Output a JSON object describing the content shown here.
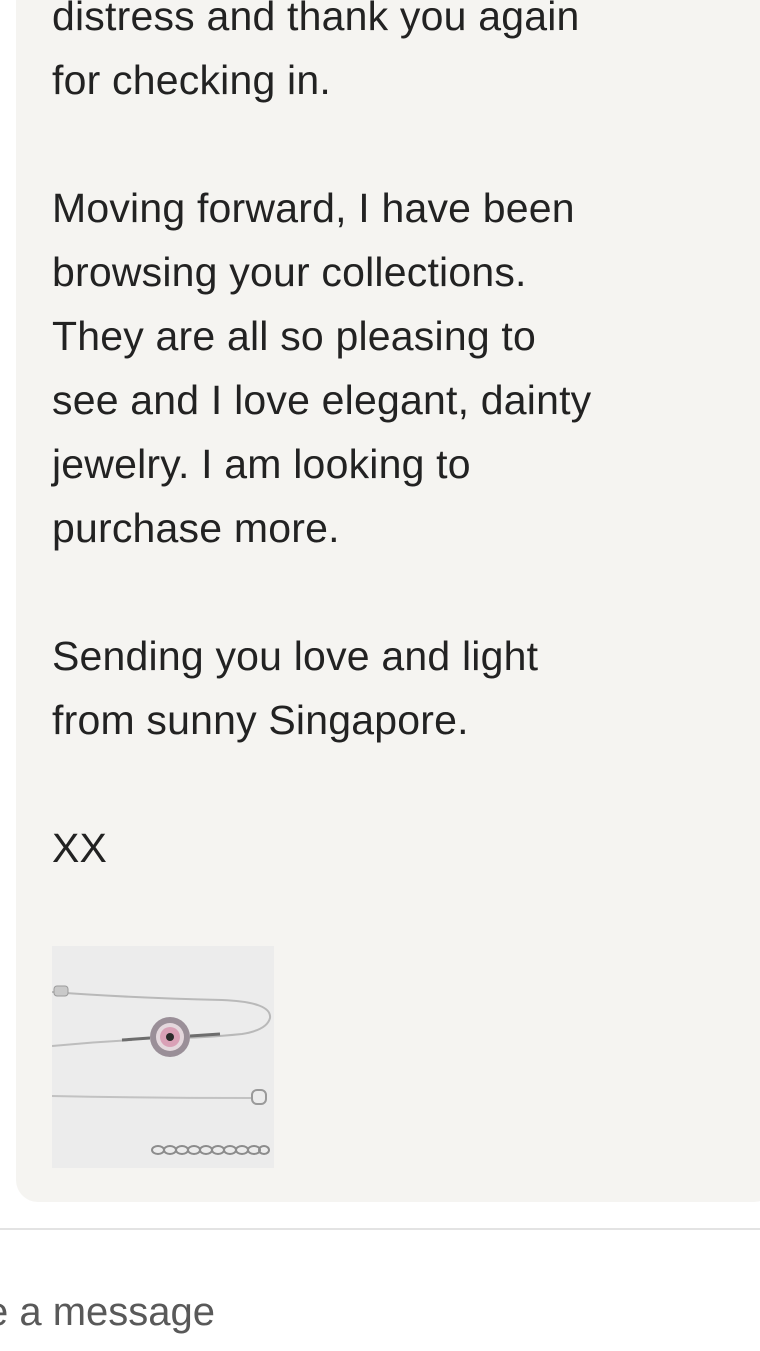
{
  "message": {
    "paragraphs": [
      "distress and thank you again\nfor checking in.",
      "Moving forward, I have been\nbrowsing your collections.\nThey are all so pleasing to\nsee and I love elegant, dainty\njewelry. I am looking to\npurchase more.",
      "Sending you love and light\nfrom sunny Singapore.",
      "XX"
    ],
    "attachment": {
      "kind": "image",
      "subject": "bracelet with pink evil-eye charm",
      "colors": {
        "background": "#ececec",
        "chain": "#b9b9b9",
        "charm_outer": "#9a8f98",
        "charm_pink": "#d9a0b6",
        "charm_center": "#2a2a2a"
      }
    }
  },
  "composer": {
    "placeholder": "e a message"
  }
}
